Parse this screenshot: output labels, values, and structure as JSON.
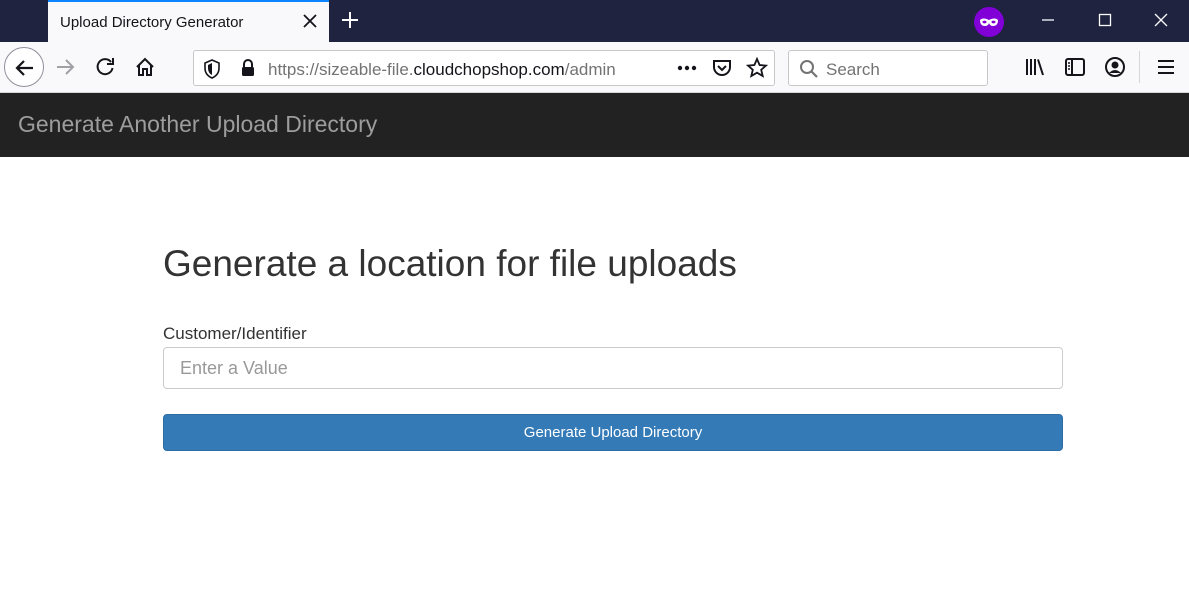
{
  "browser": {
    "tab": {
      "title": "Upload Directory Generator"
    },
    "url": {
      "prefix": "https://sizeable-file.",
      "host": "cloudchopshop.com",
      "path": "/admin"
    },
    "search": {
      "placeholder": "Search"
    },
    "colors": {
      "titlebar": "#202340",
      "tab_accent": "#0a84ff",
      "private_badge": "#8000d7"
    }
  },
  "site": {
    "brand": "Generate Another Upload Directory",
    "colors": {
      "navbar": "#222222",
      "brand_text": "#9d9d9d",
      "primary": "#337ab7"
    }
  },
  "form": {
    "heading": "Generate a location for file uploads",
    "field_label": "Customer/Identifier",
    "field_placeholder": "Enter a Value",
    "submit_label": "Generate Upload Directory"
  }
}
